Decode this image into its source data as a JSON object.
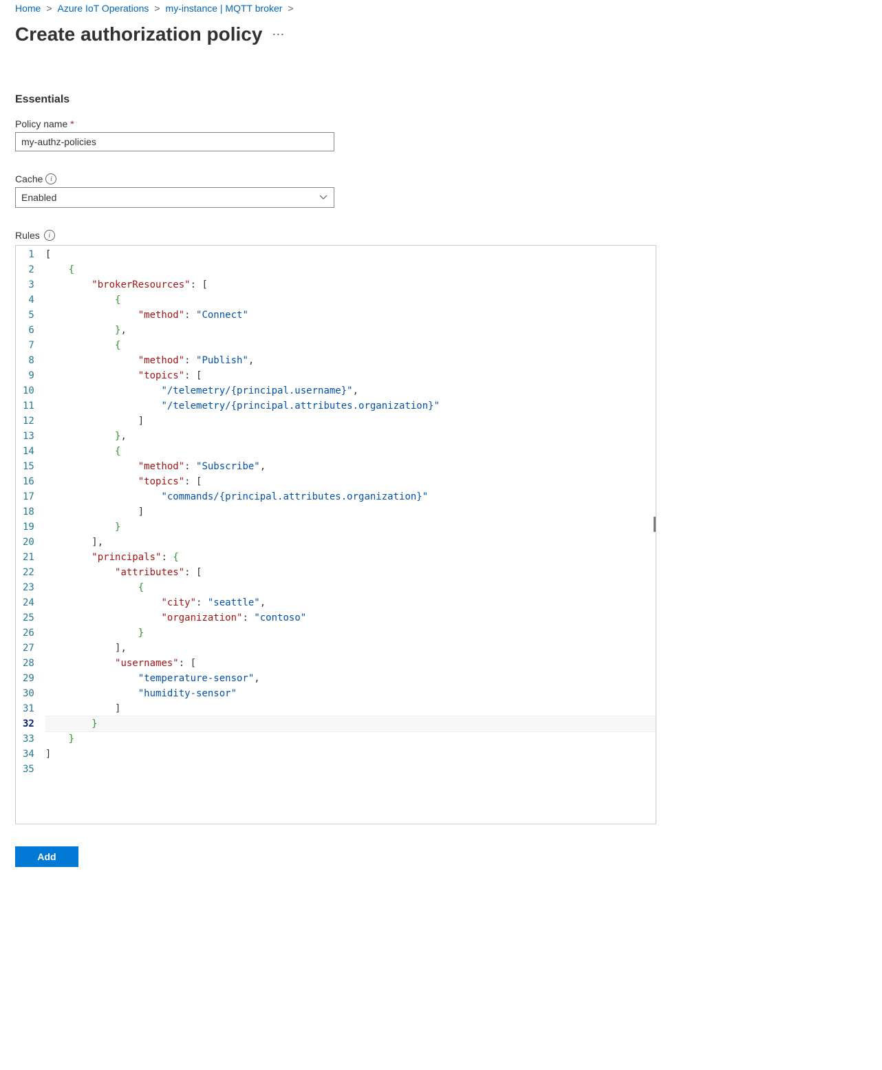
{
  "breadcrumb": {
    "items": [
      "Home",
      "Azure IoT Operations",
      "my-instance | MQTT broker"
    ],
    "sep": ">"
  },
  "title": "Create authorization policy",
  "essentials": {
    "heading": "Essentials",
    "policy_name": {
      "label": "Policy name",
      "required": "*",
      "value": "my-authz-policies"
    },
    "cache": {
      "label": "Cache",
      "value": "Enabled"
    }
  },
  "rules": {
    "label": "Rules",
    "current_line": 32,
    "total_lines": 35,
    "json_value": [
      {
        "brokerResources": [
          {
            "method": "Connect"
          },
          {
            "method": "Publish",
            "topics": [
              "/telemetry/{principal.username}",
              "/telemetry/{principal.attributes.organization}"
            ]
          },
          {
            "method": "Subscribe",
            "topics": [
              "commands/{principal.attributes.organization}"
            ]
          }
        ],
        "principals": {
          "attributes": [
            {
              "city": "seattle",
              "organization": "contoso"
            }
          ],
          "usernames": [
            "temperature-sensor",
            "humidity-sensor"
          ]
        }
      }
    ]
  },
  "footer": {
    "add": "Add"
  }
}
